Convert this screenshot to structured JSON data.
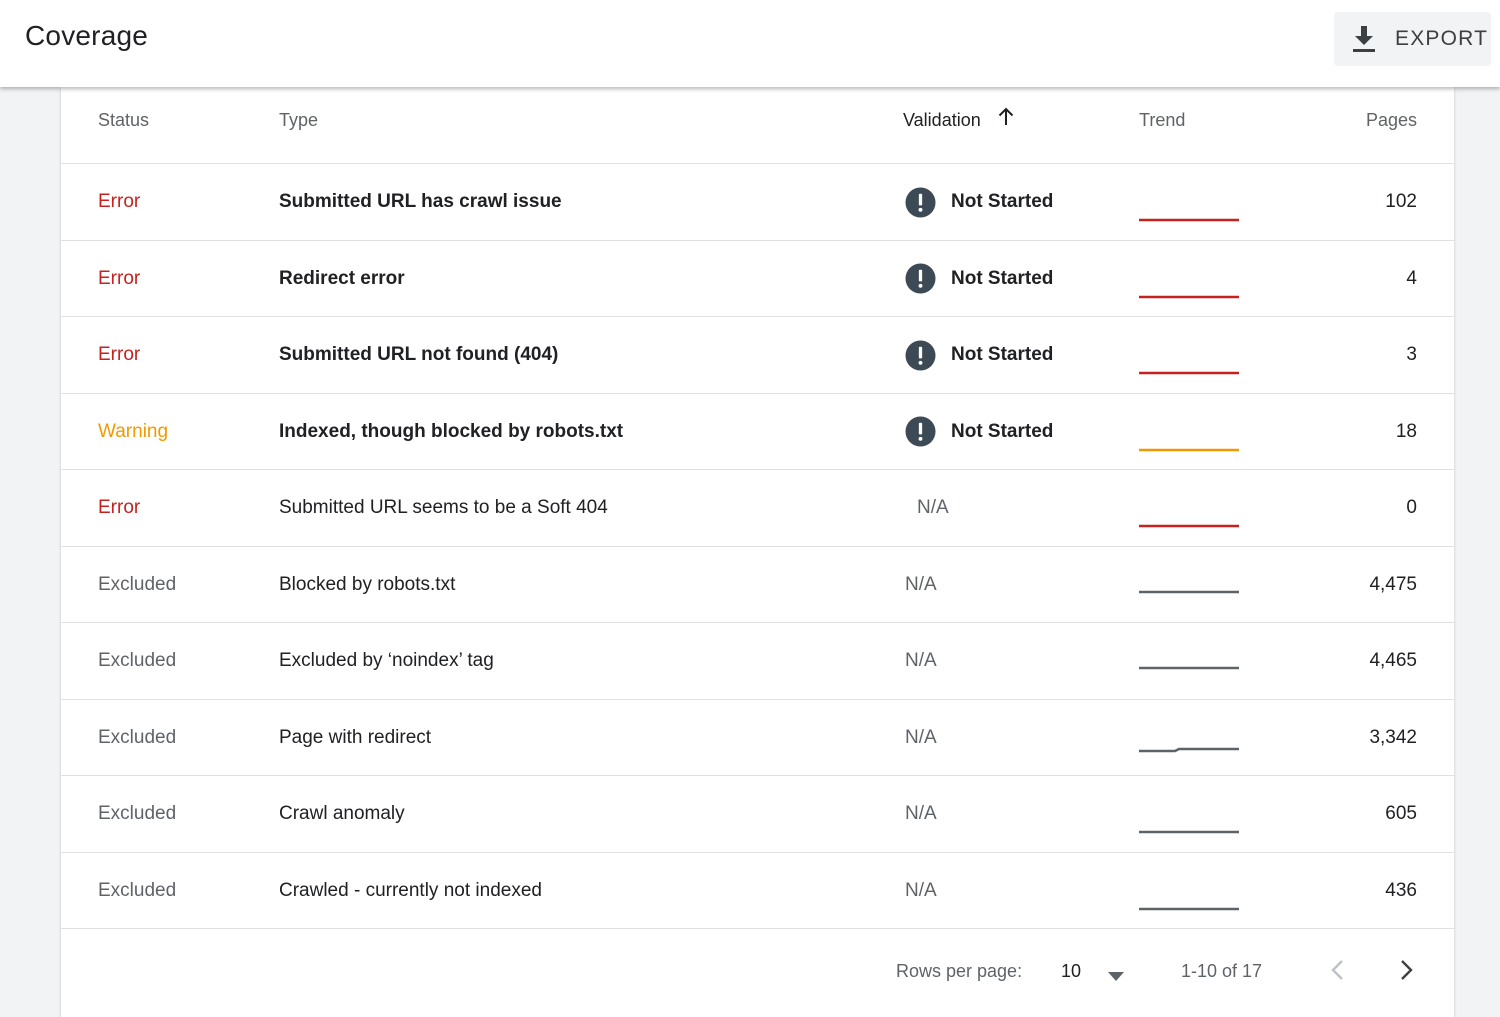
{
  "header": {
    "title": "Coverage",
    "export_label": "EXPORT",
    "export_icon": "download-icon"
  },
  "table": {
    "columns": {
      "status": "Status",
      "type": "Type",
      "validation": "Validation",
      "trend": "Trend",
      "pages": "Pages"
    },
    "sort": {
      "column": "validation",
      "direction": "ascending",
      "icon": "arrow-upward-icon"
    },
    "colors": {
      "error": "#c5221f",
      "warning": "#f29900",
      "excluded": "#5f6368",
      "validation_icon": "#3c4a56"
    },
    "rows": [
      {
        "status": "Error",
        "status_kind": "error",
        "type": "Submitted URL has crawl issue",
        "type_bold": true,
        "validation": "Not Started",
        "validation_icon": "exclamation-circle-icon",
        "trend_shape": "flat",
        "pages": "102"
      },
      {
        "status": "Error",
        "status_kind": "error",
        "type": "Redirect error",
        "type_bold": true,
        "validation": "Not Started",
        "validation_icon": "exclamation-circle-icon",
        "trend_shape": "flat",
        "pages": "4"
      },
      {
        "status": "Error",
        "status_kind": "error",
        "type": "Submitted URL not found (404)",
        "type_bold": true,
        "validation": "Not Started",
        "validation_icon": "exclamation-circle-icon",
        "trend_shape": "flat",
        "pages": "3"
      },
      {
        "status": "Warning",
        "status_kind": "warning",
        "type": "Indexed, though blocked by robots.txt",
        "type_bold": true,
        "validation": "Not Started",
        "validation_icon": "exclamation-circle-icon",
        "trend_shape": "flat",
        "pages": "18"
      },
      {
        "status": "Error",
        "status_kind": "error",
        "type": "Submitted URL seems to be a Soft 404",
        "type_bold": false,
        "validation": "N/A",
        "validation_icon": "",
        "trend_shape": "flat",
        "pages": "0"
      },
      {
        "status": "Excluded",
        "status_kind": "excluded",
        "type": "Blocked by robots.txt",
        "type_bold": false,
        "validation": "N/A",
        "validation_icon": "",
        "trend_shape": "flat-high",
        "pages": "4,475"
      },
      {
        "status": "Excluded",
        "status_kind": "excluded",
        "type": "Excluded by ‘noindex’ tag",
        "type_bold": false,
        "validation": "N/A",
        "validation_icon": "",
        "trend_shape": "flat-high",
        "pages": "4,465"
      },
      {
        "status": "Excluded",
        "status_kind": "excluded",
        "type": "Page with redirect",
        "type_bold": false,
        "validation": "N/A",
        "validation_icon": "",
        "trend_shape": "step-up",
        "pages": "3,342"
      },
      {
        "status": "Excluded",
        "status_kind": "excluded",
        "type": "Crawl anomaly",
        "type_bold": false,
        "validation": "N/A",
        "validation_icon": "",
        "trend_shape": "flat",
        "pages": "605"
      },
      {
        "status": "Excluded",
        "status_kind": "excluded",
        "type": "Crawled - currently not indexed",
        "type_bold": false,
        "validation": "N/A",
        "validation_icon": "",
        "trend_shape": "flat",
        "pages": "436"
      }
    ]
  },
  "pagination": {
    "rows_per_page_label": "Rows per page:",
    "rows_per_page_value": "10",
    "range": "1-10 of 17",
    "prev_icon": "chevron-left-icon",
    "next_icon": "chevron-right-icon"
  }
}
